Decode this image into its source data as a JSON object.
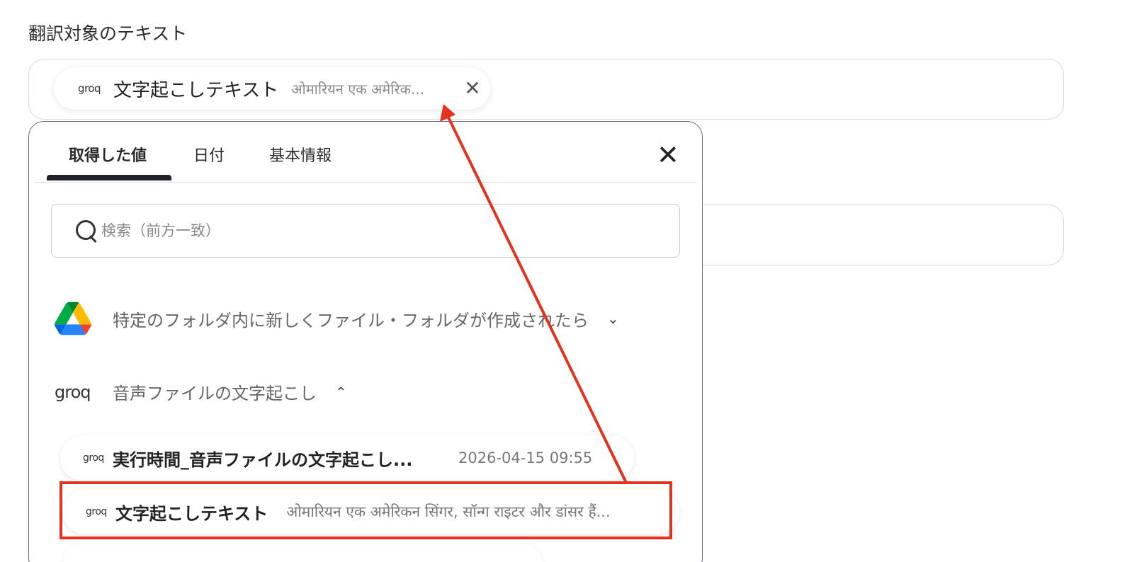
{
  "form": {
    "section_label": "翻訳対象のテキスト",
    "selected_chip": {
      "logo": "groq",
      "name": "文字起こしテキスト",
      "preview": "ओमारियन एक अमेरिक..."
    }
  },
  "picker": {
    "tabs": [
      "取得した値",
      "日付",
      "基本情報"
    ],
    "active_tab": "取得した値",
    "search_placeholder": "検索（前方一致）",
    "groups": [
      {
        "icon": "google-drive-icon",
        "title": "特定のフォルダ内に新しくファイル・フォルダが作成されたら",
        "expanded": false
      },
      {
        "icon": "groq-logo",
        "logo_text": "groq",
        "title": "音声ファイルの文字起こし",
        "expanded": true
      }
    ],
    "items": [
      {
        "logo": "groq",
        "name": "実行時間_音声ファイルの文字起こし...",
        "meta": "2026-04-15 09:55"
      },
      {
        "logo": "groq",
        "name": "文字起こしテキスト",
        "meta": "ओमारियन एक अमेरिकन सिंगर, सॉन्ग राइटर और डांसर हैं..."
      }
    ]
  },
  "annotation": {
    "color": "#e4321f",
    "highlighted_item": "文字起こしテキスト"
  }
}
